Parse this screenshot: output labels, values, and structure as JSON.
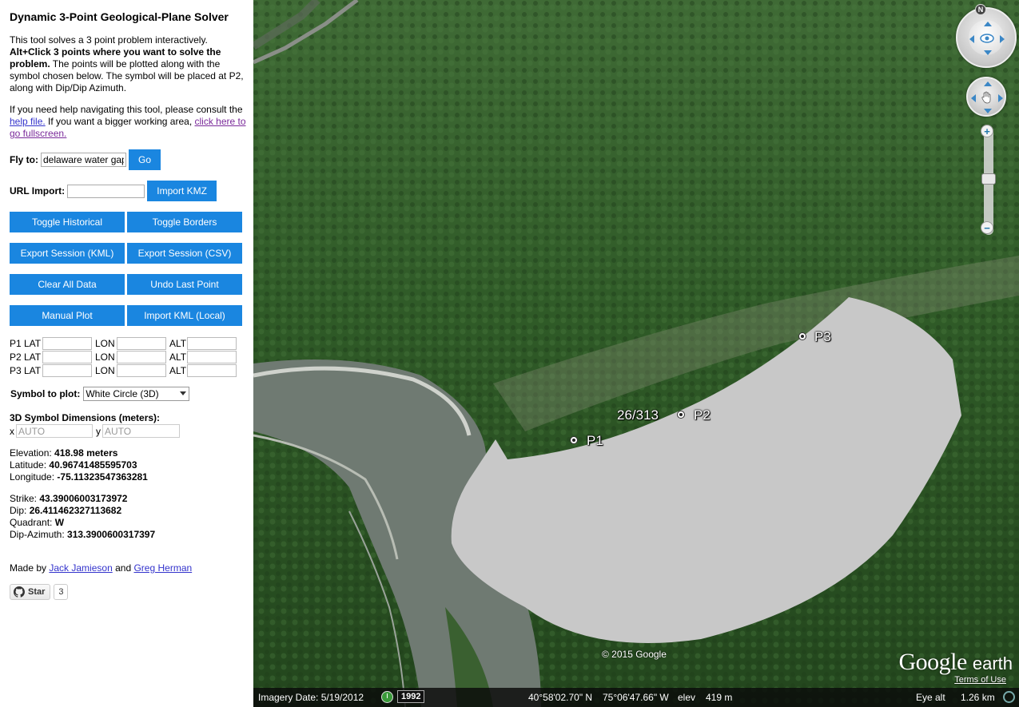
{
  "sidebar": {
    "title": "Dynamic 3-Point Geological-Plane Solver",
    "intro_plain_1": "This tool solves a 3 point problem interactively.",
    "intro_bold": "Alt+Click 3 points where you want to solve the problem.",
    "intro_plain_2": "The points will be plotted along with the symbol chosen below. The symbol will be placed at P2, along with Dip/Dip Azimuth.",
    "help_pre": "If you need help navigating this tool, please consult the",
    "help_link": "help file.",
    "help_mid": "If you want a bigger working area,",
    "fullscreen_link": "click here to go fullscreen.",
    "fly_to_label": "Fly to:",
    "fly_to_value": "delaware water gap",
    "go_label": "Go",
    "url_import_label": "URL Import:",
    "url_import_value": "",
    "import_kmz_label": "Import KMZ",
    "buttons": [
      "Toggle Historical",
      "Toggle Borders",
      "Export Session (KML)",
      "Export Session (CSV)",
      "Clear All Data",
      "Undo Last Point",
      "Manual Plot",
      "Import KML (Local)"
    ],
    "coord_rows": [
      {
        "lat_label": "P1 LAT",
        "lon_label": "LON",
        "alt_label": "ALT"
      },
      {
        "lat_label": "P2 LAT",
        "lon_label": "LON",
        "alt_label": "ALT"
      },
      {
        "lat_label": "P3 LAT",
        "lon_label": "LON",
        "alt_label": "ALT"
      }
    ],
    "symbol_label": "Symbol to plot:",
    "symbol_value": "White Circle (3D)",
    "dims_label": "3D Symbol Dimensions (meters):",
    "dim_x_label": "x",
    "dim_x_placeholder": "AUTO",
    "dim_y_label": "y",
    "dim_y_placeholder": "AUTO",
    "elevation_label": "Elevation:",
    "elevation_value": "418.98 meters",
    "latitude_label": "Latitude:",
    "latitude_value": "40.96741485595703",
    "longitude_label": "Longitude:",
    "longitude_value": "-75.11323547363281",
    "strike_label": "Strike:",
    "strike_value": "43.39006003173972",
    "dip_label": "Dip:",
    "dip_value": "26.411462327113682",
    "quadrant_label": "Quadrant:",
    "quadrant_value": "W",
    "dip_azimuth_label": "Dip-Azimuth:",
    "dip_azimuth_value": "313.3900600317397",
    "made_by_pre": "Made by",
    "author_1": "Jack Jamieson",
    "made_by_and": "and",
    "author_2": "Greg Herman",
    "star_label": "Star",
    "star_count": "3"
  },
  "map": {
    "p1_label": "P1",
    "p2_label": "P2",
    "p3_label": "P3",
    "dip_label": "26/313",
    "copyright": "© 2015 Google",
    "logo_google": "Google",
    "logo_earth": "earth",
    "terms": "Terms of Use",
    "compass_n": "N",
    "zoom_in": "+",
    "zoom_out": "−",
    "status": {
      "imagery_date": "Imagery Date: 5/19/2012",
      "year": "1992",
      "lat": "40°58'02.70\" N",
      "lon": "75°06'47.66\" W",
      "elev_label": "elev",
      "elev_value": "419 m",
      "eye_label": "Eye alt",
      "eye_value": "1.26 km"
    },
    "colors": {
      "plane_fill": "#c8c8c8",
      "forest": "#2f5a27",
      "river": "#6f7a72",
      "button": "#1a86e0"
    }
  }
}
